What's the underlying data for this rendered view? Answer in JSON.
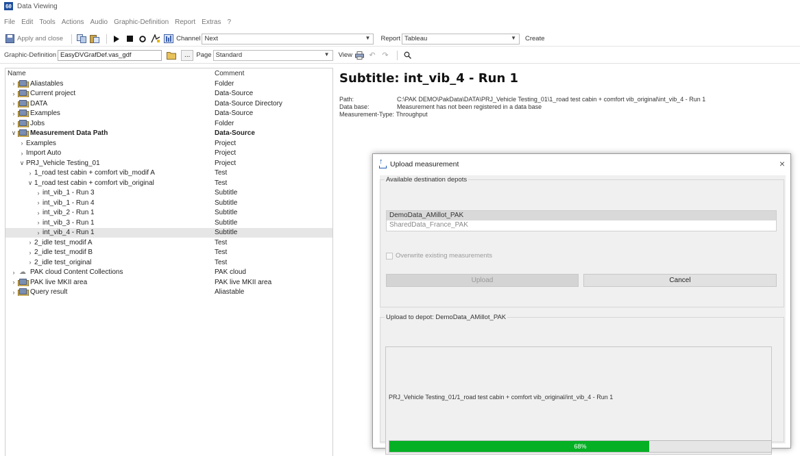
{
  "window": {
    "app_icon_text": "6θ",
    "title": "Data Viewing"
  },
  "menu": [
    "File",
    "Edit",
    "Tools",
    "Actions",
    "Audio",
    "Graphic-Definition",
    "Report",
    "Extras",
    "?"
  ],
  "toolbar1": {
    "apply_close": "Apply and close",
    "channel_label": "Channel",
    "channel_value": "Next",
    "report_label": "Report",
    "report_value": "Tableau",
    "create": "Create"
  },
  "toolbar2": {
    "gd_label": "Graphic-Definition",
    "gd_value": "EasyDVGrafDef.vas_gdf",
    "browse": "...",
    "page_label": "Page",
    "page_value": "Standard",
    "view_label": "View"
  },
  "tree": {
    "header_name": "Name",
    "header_comment": "Comment",
    "rows": [
      {
        "level": 0,
        "chev": ">",
        "icon": "folder",
        "name": "Aliastables",
        "comment": "Folder"
      },
      {
        "level": 0,
        "chev": ">",
        "icon": "folder",
        "name": "Current project",
        "comment": "Data-Source"
      },
      {
        "level": 0,
        "chev": ">",
        "icon": "folder",
        "name": "DATA",
        "comment": "Data-Source Directory"
      },
      {
        "level": 0,
        "chev": ">",
        "icon": "folder",
        "name": "Examples",
        "comment": "Data-Source"
      },
      {
        "level": 0,
        "chev": ">",
        "icon": "folder",
        "name": "Jobs",
        "comment": "Folder"
      },
      {
        "level": 0,
        "chev": "v",
        "icon": "folder-open",
        "name": "Measurement Data Path",
        "comment": "Data-Source",
        "bold": true
      },
      {
        "level": 1,
        "chev": ">",
        "icon": "",
        "name": "Examples",
        "comment": "Project"
      },
      {
        "level": 1,
        "chev": ">",
        "icon": "",
        "name": "Import Auto",
        "comment": "Project"
      },
      {
        "level": 1,
        "chev": "v",
        "icon": "",
        "name": "PRJ_Vehicle Testing_01",
        "comment": "Project"
      },
      {
        "level": 2,
        "chev": ">",
        "icon": "",
        "name": "1_road test cabin + comfort vib_modif A",
        "comment": "Test"
      },
      {
        "level": 2,
        "chev": "v",
        "icon": "",
        "name": "1_road test cabin + comfort vib_original",
        "comment": "Test"
      },
      {
        "level": 3,
        "chev": ">",
        "icon": "",
        "name": "int_vib_1 - Run 3",
        "comment": "Subtitle"
      },
      {
        "level": 3,
        "chev": ">",
        "icon": "",
        "name": "int_vib_1 - Run 4",
        "comment": "Subtitle"
      },
      {
        "level": 3,
        "chev": ">",
        "icon": "",
        "name": "int_vib_2 - Run 1",
        "comment": "Subtitle"
      },
      {
        "level": 3,
        "chev": ">",
        "icon": "",
        "name": "int_vib_3 - Run 1",
        "comment": "Subtitle"
      },
      {
        "level": 3,
        "chev": ">",
        "icon": "",
        "name": "int_vib_4 - Run 1",
        "comment": "Subtitle",
        "selected": true
      },
      {
        "level": 2,
        "chev": ">",
        "icon": "",
        "name": "2_idle test_modif A",
        "comment": "Test"
      },
      {
        "level": 2,
        "chev": ">",
        "icon": "",
        "name": "2_idle test_modif B",
        "comment": "Test"
      },
      {
        "level": 2,
        "chev": ">",
        "icon": "",
        "name": "2_idle test_original",
        "comment": "Test"
      },
      {
        "level": 0,
        "chev": ">",
        "icon": "cloud",
        "name": "PAK cloud Content Collections",
        "comment": "PAK cloud"
      },
      {
        "level": 0,
        "chev": ">",
        "icon": "folder",
        "name": "PAK live MKII area",
        "comment": "PAK live MKII area"
      },
      {
        "level": 0,
        "chev": ">",
        "icon": "folder",
        "name": "Query result",
        "comment": "Aliastable"
      }
    ]
  },
  "content": {
    "subtitle": "Subtitle: int_vib_4 - Run 1",
    "path_label": "Path:",
    "path_value": "C:\\PAK DEMO\\PakData\\DATA\\PRJ_Vehicle Testing_01\\1_road test cabin + comfort vib_original\\int_vib_4 - Run 1",
    "db_label": "Data base:",
    "db_value": "Measurement has not been registered in a data base",
    "type_label": "Measurement-Type:",
    "type_value": "Throughput"
  },
  "dialog": {
    "title": "Upload measurement",
    "close": "×",
    "group1_title": "Available destination depots",
    "depots": [
      "DemoData_AMillot_PAK",
      "SharedData_France_PAK"
    ],
    "overwrite_label": "Overwrite existing measurements",
    "upload_label": "Upload",
    "cancel_label": "Cancel",
    "group2_title": "Upload to depot: DemoData_AMillot_PAK",
    "upload_path": "PRJ_Vehicle Testing_01/1_road test cabin + comfort vib_original/int_vib_4 - Run 1",
    "progress_percent": 68,
    "progress_text": "68%",
    "progress_color": "#06b025"
  }
}
